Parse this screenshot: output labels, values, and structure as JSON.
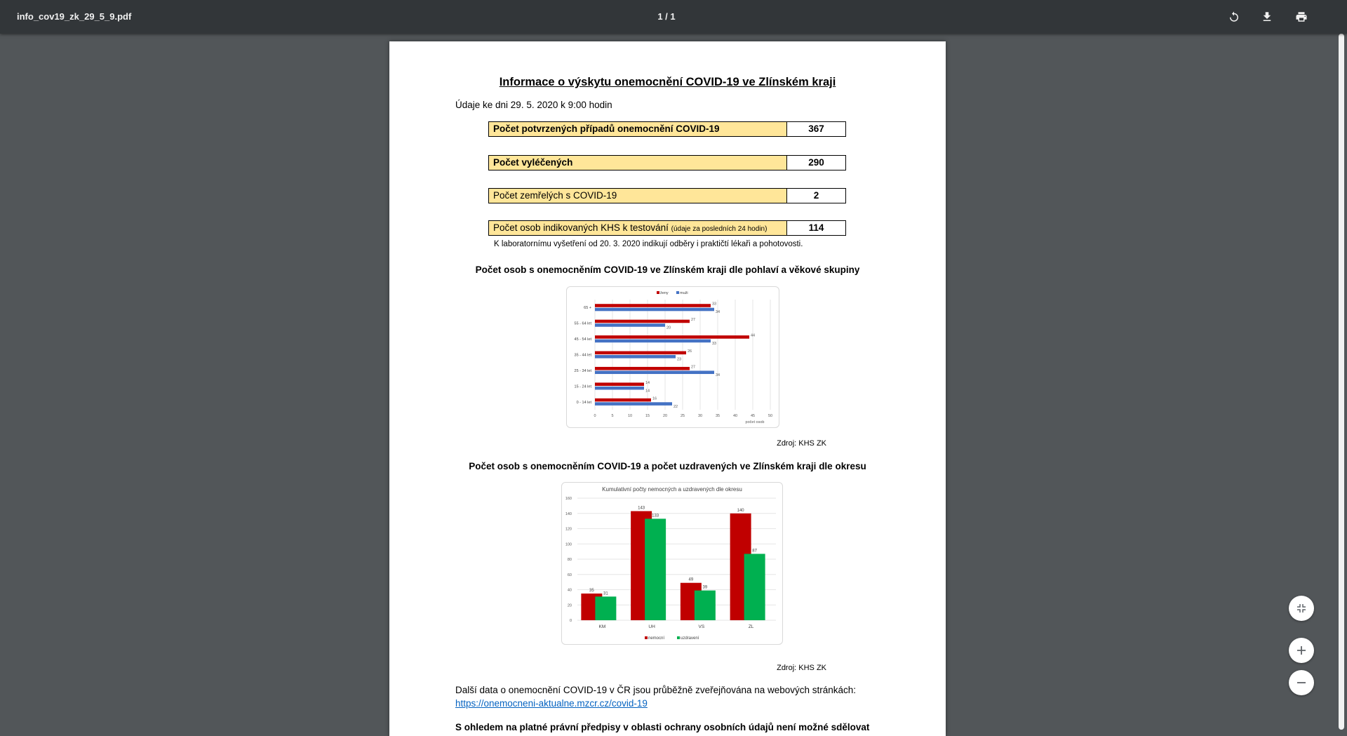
{
  "toolbar": {
    "title": "info_cov19_zk_29_5_9.pdf",
    "page_indicator": "1 / 1",
    "rotate_icon": "rotate-icon",
    "download_icon": "download-icon",
    "print_icon": "print-icon"
  },
  "document": {
    "heading": "Informace o výskytu onemocnění COVID-19 ve Zlínském kraji",
    "date_line": "Údaje ke dni 29. 5. 2020 k 9:00 hodin",
    "stats": [
      {
        "label": "Počet potvrzených případů onemocnění COVID-19",
        "value": "367",
        "bold": true
      },
      {
        "label": "Počet vyléčených",
        "value": "290",
        "bold": true
      },
      {
        "label": "Počet zemřelých s COVID-19",
        "value": "2",
        "bold": false
      },
      {
        "label": "Počet osob indikovaných KHS k testování",
        "note": "(údaje za posledních 24 hodin)",
        "value": "114",
        "bold": false
      }
    ],
    "lab_note": "K laboratornímu vyšetření od 20. 3. 2020 indikují odběry i praktičtí lékaři a pohotovosti.",
    "section1_title": "Počet osob s onemocněním COVID-19 ve Zlínském kraji dle pohlaví a věkové skupiny",
    "source1": "Zdroj: KHS ZK",
    "section2_title": "Počet osob s onemocněním COVID-19 a počet uzdravených ve Zlínském kraji dle okresu",
    "source2": "Zdroj: KHS ZK",
    "more_text": "Další data o onemocnění COVID-19 v ČR jsou průběžně zveřejňována na webových stránkách:",
    "more_link": "https://onemocneni-aktualne.mzcr.cz/covid-19",
    "cut_text": "S ohledem na platné právní předpisy v oblasti ochrany osobních údajů není možné sdělovat"
  },
  "colors": {
    "red": "#c00000",
    "blue": "#4472c4",
    "green": "#00b050",
    "box_fill": "#ffe699"
  },
  "chart_data": [
    {
      "type": "bar",
      "orientation": "horizontal",
      "categories": [
        "65 +",
        "55 - 64 let",
        "45 - 54 let",
        "35 - 44 let",
        "25 - 34 let",
        "15 - 24 let",
        "0 - 14 let"
      ],
      "series": [
        {
          "name": "ženy",
          "values": [
            33,
            27,
            44,
            26,
            27,
            14,
            16
          ]
        },
        {
          "name": "muži",
          "values": [
            34,
            20,
            33,
            23,
            34,
            14,
            22
          ]
        }
      ],
      "x_ticks": [
        0,
        5,
        10,
        15,
        20,
        25,
        30,
        35,
        40,
        45,
        50
      ],
      "xlim": [
        0,
        50
      ],
      "xlabel": "počet osob",
      "legend": "top"
    },
    {
      "type": "bar",
      "title": "Kumulativní počty nemocných a uzdravených dle okresu",
      "categories": [
        "KM",
        "UH",
        "VS",
        "ZL"
      ],
      "series": [
        {
          "name": "nemocní",
          "values": [
            35,
            143,
            49,
            140
          ]
        },
        {
          "name": "uzdravení",
          "values": [
            31,
            133,
            39,
            87
          ]
        }
      ],
      "y_ticks": [
        0,
        20,
        40,
        60,
        80,
        100,
        120,
        140,
        160
      ],
      "ylim": [
        0,
        160
      ],
      "legend": "bottom"
    }
  ],
  "controls": {
    "fit_icon": "fit-page-icon",
    "zoom_in_icon": "zoom-in-icon",
    "zoom_out_icon": "zoom-out-icon"
  }
}
